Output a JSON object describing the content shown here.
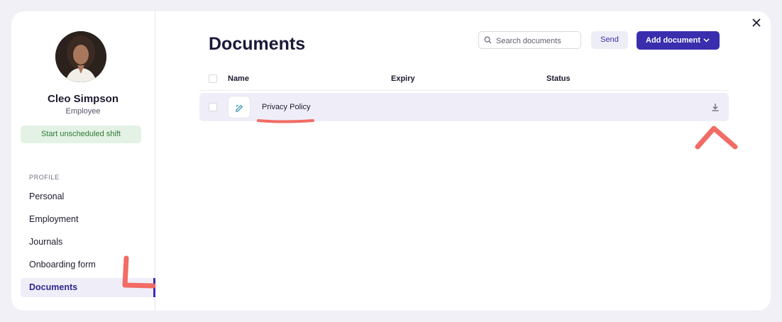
{
  "user": {
    "name": "Cleo Simpson",
    "role": "Employee",
    "shift_button": "Start unscheduled shift"
  },
  "sidebar": {
    "section_label": "PROFILE",
    "items": [
      {
        "label": "Personal"
      },
      {
        "label": "Employment"
      },
      {
        "label": "Journals"
      },
      {
        "label": "Onboarding form"
      },
      {
        "label": "Documents",
        "active": true
      }
    ]
  },
  "main": {
    "title": "Documents",
    "search_placeholder": "Search documents",
    "send_label": "Send",
    "add_label": "Add document"
  },
  "table": {
    "columns": [
      "Name",
      "Expiry",
      "Status"
    ],
    "rows": [
      {
        "name": "Privacy Policy",
        "expiry": "",
        "status": ""
      }
    ]
  },
  "colors": {
    "accent": "#3a2eae",
    "shift_bg": "#e3f2e4",
    "annotation": "#f26b64"
  },
  "icons": [
    "close-icon",
    "search-icon",
    "chevron-down-icon",
    "signature-icon",
    "download-icon"
  ]
}
